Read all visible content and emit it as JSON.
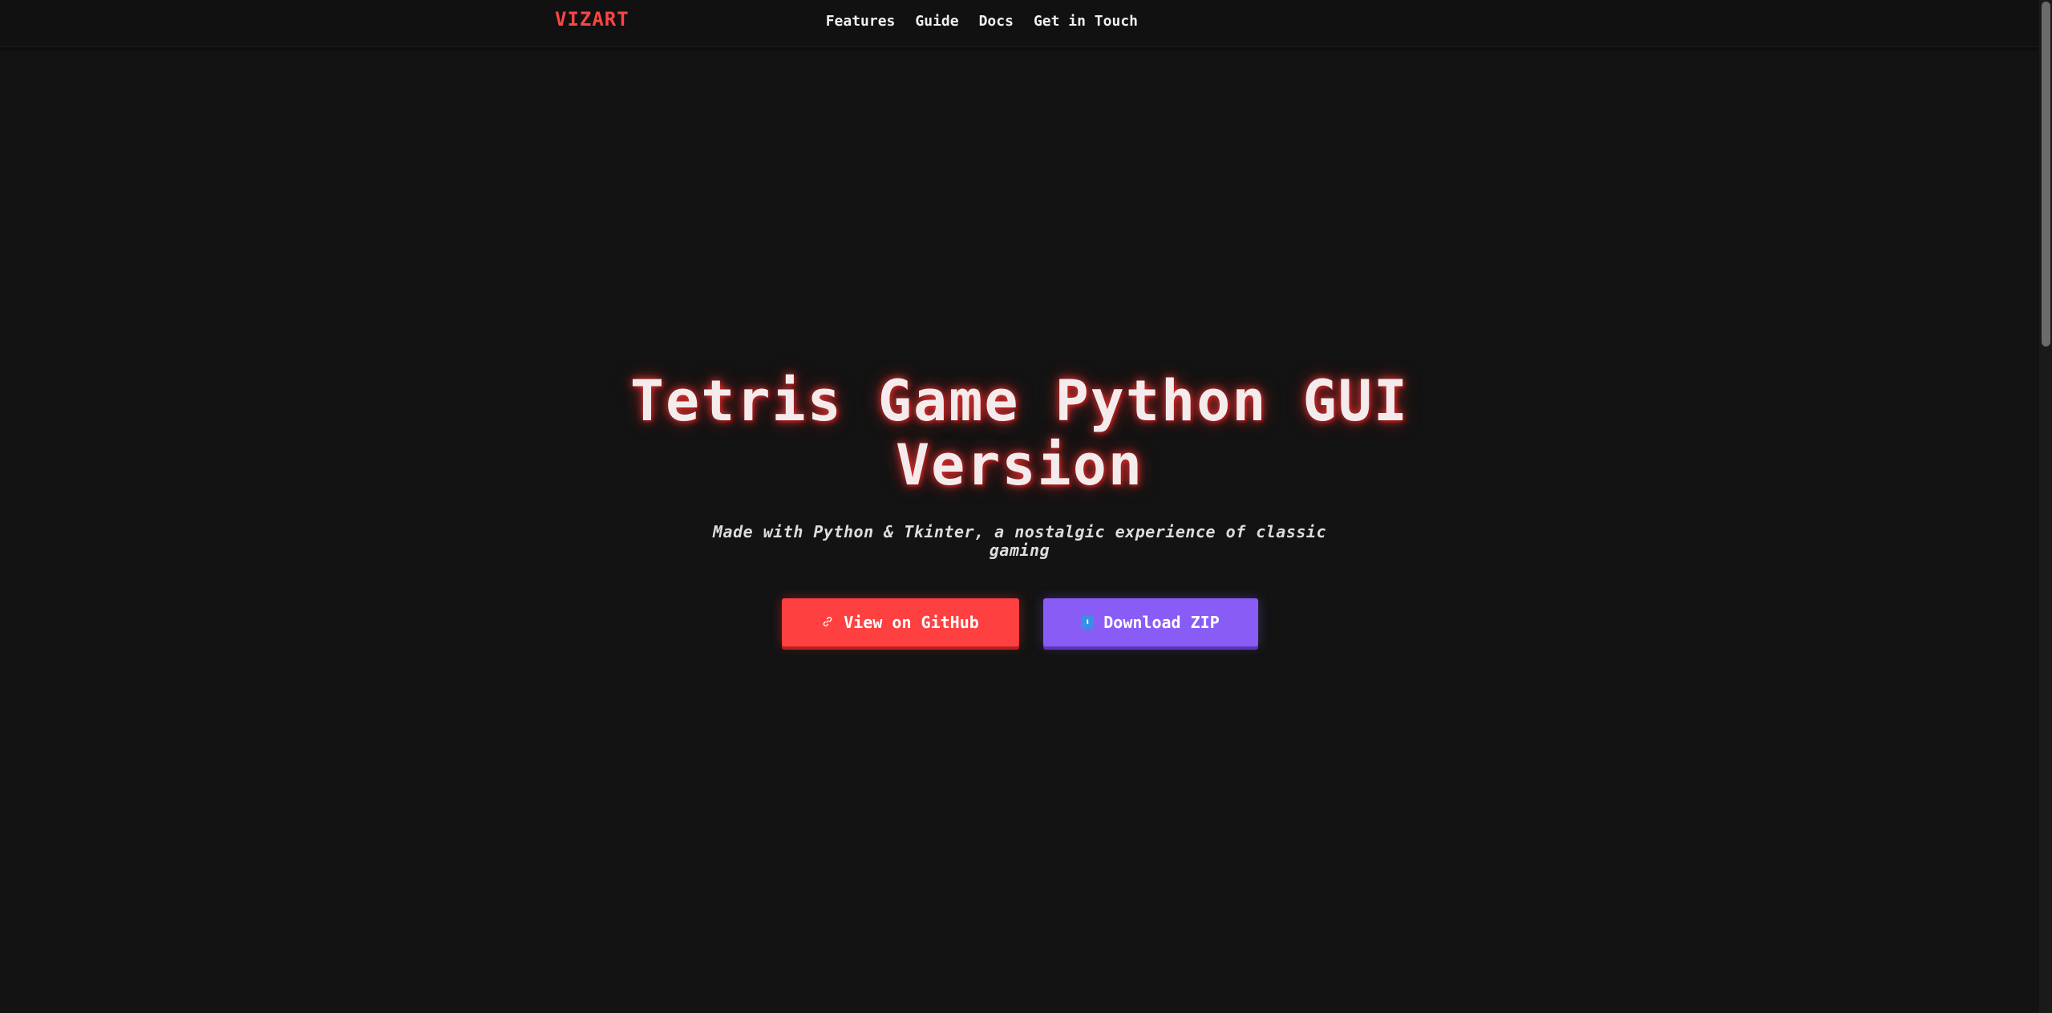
{
  "nav": {
    "logo": "VIZART",
    "links": [
      {
        "label": "Features"
      },
      {
        "label": "Guide"
      },
      {
        "label": "Docs"
      },
      {
        "label": "Get in Touch"
      }
    ]
  },
  "hero": {
    "title": "Tetris Game Python GUI Version",
    "subtitle": "Made with Python & Tkinter, a nostalgic experience of classic gaming",
    "buttons": {
      "github": {
        "label": "View on GitHub",
        "icon": "link-icon",
        "color": "#ff4040"
      },
      "download": {
        "label": "Download ZIP",
        "icon": "download-icon",
        "color": "#8a5cf6"
      }
    }
  },
  "colors": {
    "background": "#131313",
    "accent": "#ff4444"
  }
}
